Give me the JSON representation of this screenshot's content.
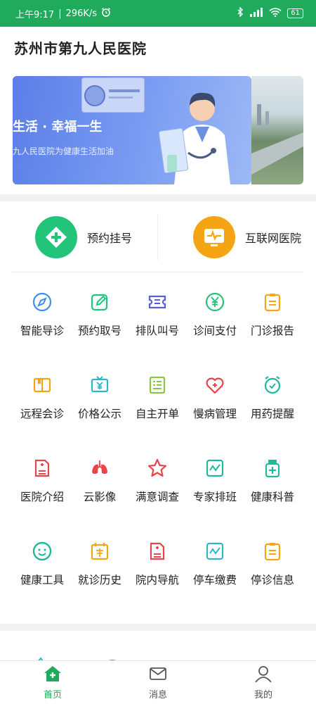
{
  "status_bar": {
    "time": "上午9:17",
    "speed": "296K/s",
    "battery": "61"
  },
  "header": {
    "title": "苏州市第九人民医院"
  },
  "banner": {
    "slogan": "生活 · 幸福一生",
    "subtitle": "九人民医院为健康生活加油"
  },
  "quick_entries": [
    {
      "label": "预约挂号",
      "icon": "plus-cross-icon",
      "color": "#22c47a"
    },
    {
      "label": "互联网医院",
      "icon": "monitor-pulse-icon",
      "color": "#f5a414"
    }
  ],
  "services": [
    [
      {
        "label": "智能导诊",
        "icon": "navigation-icon",
        "color": "#3b8ef0"
      },
      {
        "label": "预约取号",
        "icon": "edit-icon",
        "color": "#22c47a"
      },
      {
        "label": "排队叫号",
        "icon": "ticket-icon",
        "color": "#5b5fd6"
      },
      {
        "label": "诊间支付",
        "icon": "yen-icon",
        "color": "#22c47a"
      },
      {
        "label": "门诊报告",
        "icon": "clipboard-icon",
        "color": "#f5a414"
      }
    ],
    [
      {
        "label": "远程会诊",
        "icon": "book-icon",
        "color": "#f5a414"
      },
      {
        "label": "价格公示",
        "icon": "tv-yen-icon",
        "color": "#2cb7c9"
      },
      {
        "label": "自主开单",
        "icon": "form-icon",
        "color": "#8cc63f"
      },
      {
        "label": "慢病管理",
        "icon": "heart-pulse-icon",
        "color": "#e8454b"
      },
      {
        "label": "用药提醒",
        "icon": "alarm-clock-icon",
        "color": "#1fb89a"
      }
    ],
    [
      {
        "label": "医院介绍",
        "icon": "hospital-doc-icon",
        "color": "#e8454b"
      },
      {
        "label": "云影像",
        "icon": "lungs-icon",
        "color": "#e8454b"
      },
      {
        "label": "满意调查",
        "icon": "star-icon",
        "color": "#e8454b"
      },
      {
        "label": "专家排班",
        "icon": "chart-wave-icon",
        "color": "#1fb89a"
      },
      {
        "label": "健康科普",
        "icon": "medicine-bottle-icon",
        "color": "#1fb89a"
      }
    ],
    [
      {
        "label": "健康工具",
        "icon": "smiley-icon",
        "color": "#1fb89a"
      },
      {
        "label": "就诊历史",
        "icon": "calendar-check-icon",
        "color": "#f5a414"
      },
      {
        "label": "院内导航",
        "icon": "hospital-doc-icon",
        "color": "#e8454b"
      },
      {
        "label": "停车缴费",
        "icon": "chart-wave-icon",
        "color": "#2cb7c9"
      },
      {
        "label": "停诊信息",
        "icon": "clipboard-icon",
        "color": "#f5a414"
      }
    ]
  ],
  "tabbar": {
    "items": [
      {
        "label": "首页",
        "icon": "home-plus-icon",
        "active": true
      },
      {
        "label": "消息",
        "icon": "mail-icon",
        "active": false
      },
      {
        "label": "我的",
        "icon": "user-icon",
        "active": false
      }
    ],
    "active_color": "#1faa5c",
    "inactive_color": "#555555"
  }
}
